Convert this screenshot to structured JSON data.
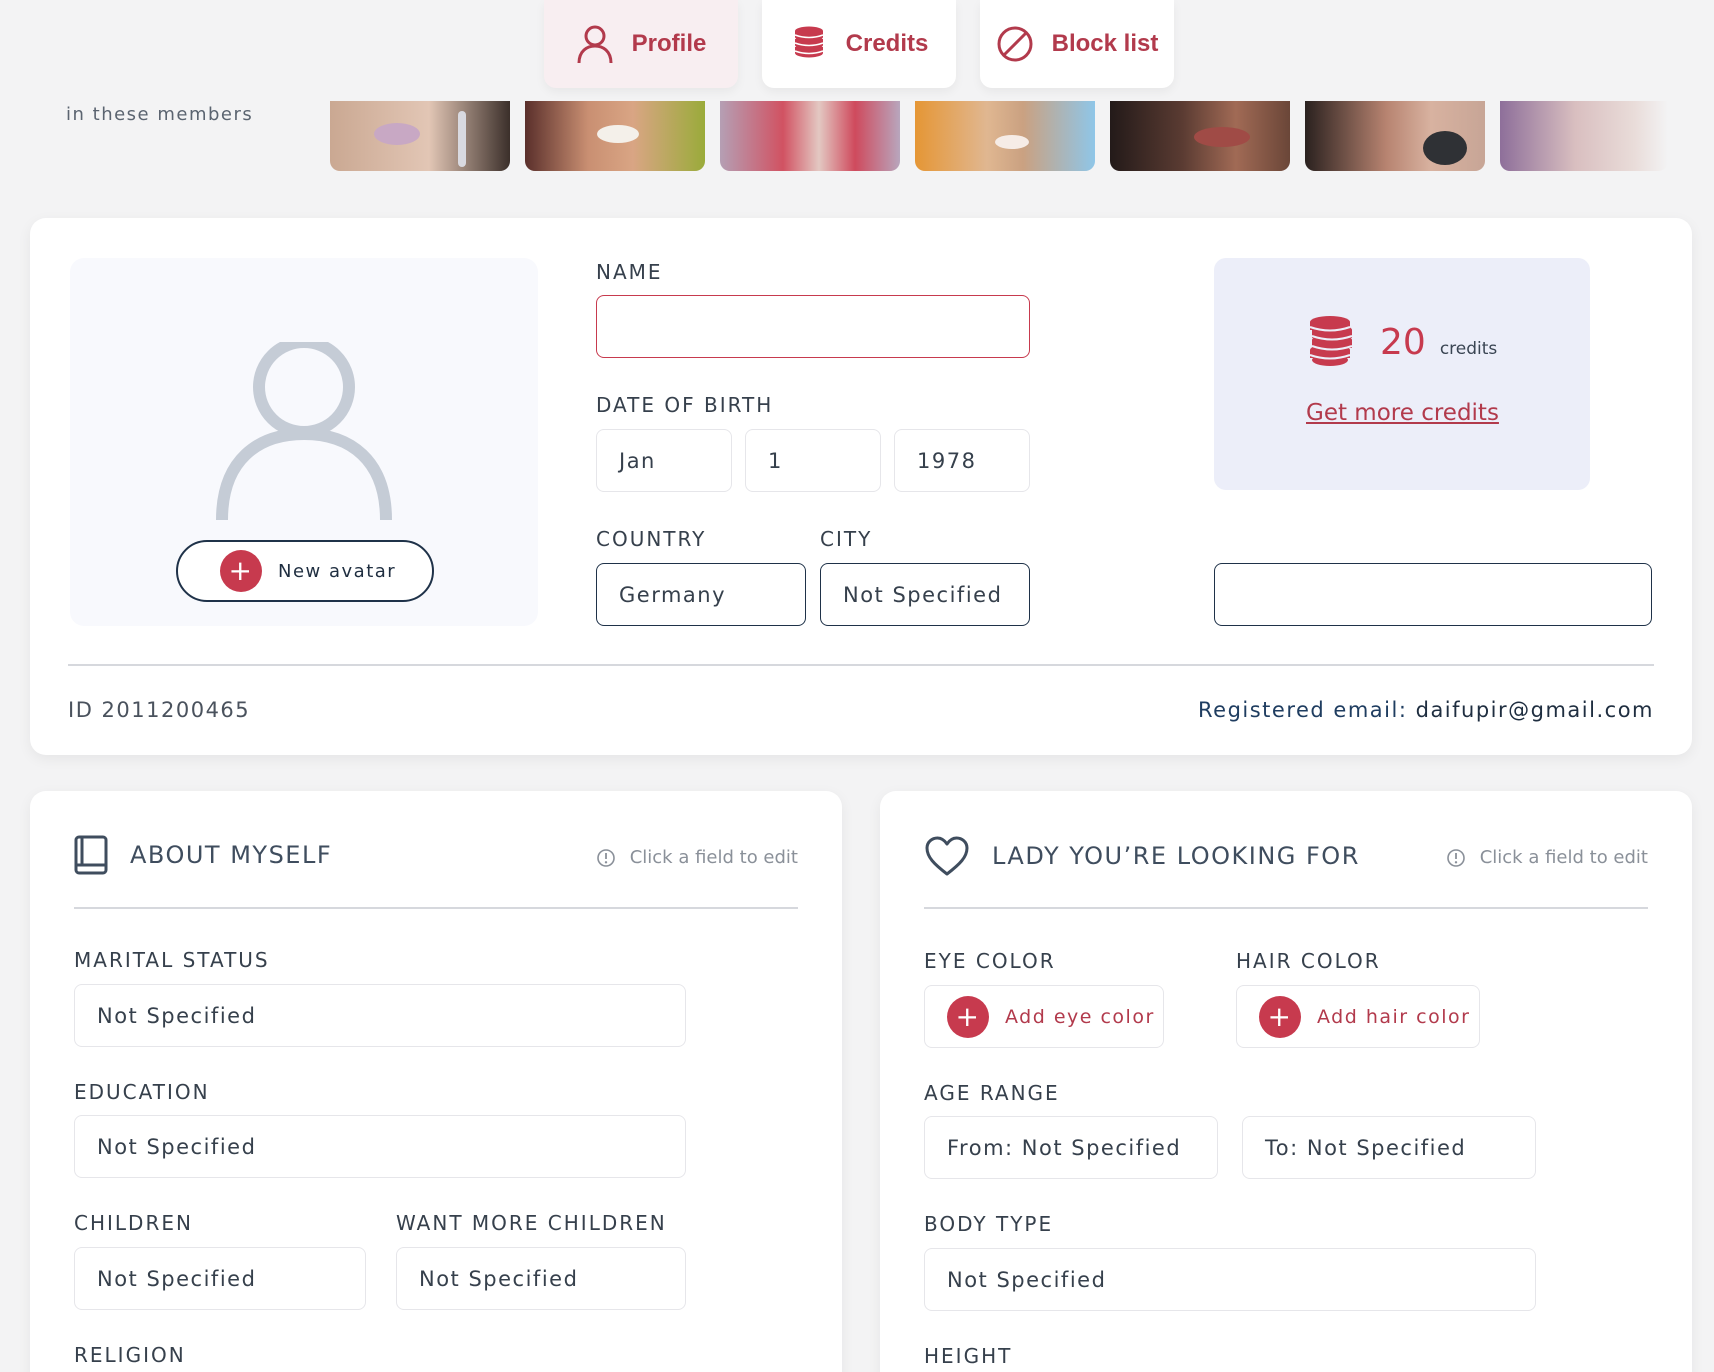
{
  "tabs": [
    {
      "label": "Profile",
      "icon": "user-icon",
      "active": true
    },
    {
      "label": "Credits",
      "icon": "coins-icon",
      "active": false
    },
    {
      "label": "Block list",
      "icon": "block-icon",
      "active": false
    }
  ],
  "teaser": {
    "label": "in these members"
  },
  "profile": {
    "avatar_button": "New avatar",
    "name_label": "NAME",
    "name_value": "",
    "dob_label": "DATE OF BIRTH",
    "dob_month": "Jan",
    "dob_day": "1",
    "dob_year": "1978",
    "country_label": "COUNTRY",
    "country_value": "Germany",
    "city_label": "CITY",
    "city_value": "Not Specified",
    "extra_field_value": ""
  },
  "credits": {
    "amount": "20",
    "unit": "credits",
    "link": "Get more credits"
  },
  "account": {
    "id": "ID 2011200465",
    "email_label": "Registered email:",
    "email": "daifupir@gmail.com"
  },
  "about": {
    "title": "ABOUT MYSELF",
    "hint": "Click a field to edit",
    "marital_label": "MARITAL STATUS",
    "marital_value": "Not Specified",
    "education_label": "EDUCATION",
    "education_value": "Not Specified",
    "children_label": "CHILDREN",
    "children_value": "Not Specified",
    "more_children_label": "WANT MORE CHILDREN",
    "more_children_value": "Not Specified",
    "religion_label": "RELIGION"
  },
  "lady": {
    "title": "LADY YOU’RE LOOKING FOR",
    "hint": "Click a field to edit",
    "eye_label": "EYE COLOR",
    "eye_button": "Add eye color",
    "hair_label": "HAIR COLOR",
    "hair_button": "Add hair color",
    "age_label": "AGE RANGE",
    "age_from": "From: Not Specified",
    "age_to": "To: Not Specified",
    "body_label": "BODY TYPE",
    "body_value": "Not Specified",
    "height_label": "HEIGHT"
  },
  "colors": {
    "accent": "#c73a4e",
    "navy": "#1f3249",
    "credits_bg": "#eceef9"
  }
}
